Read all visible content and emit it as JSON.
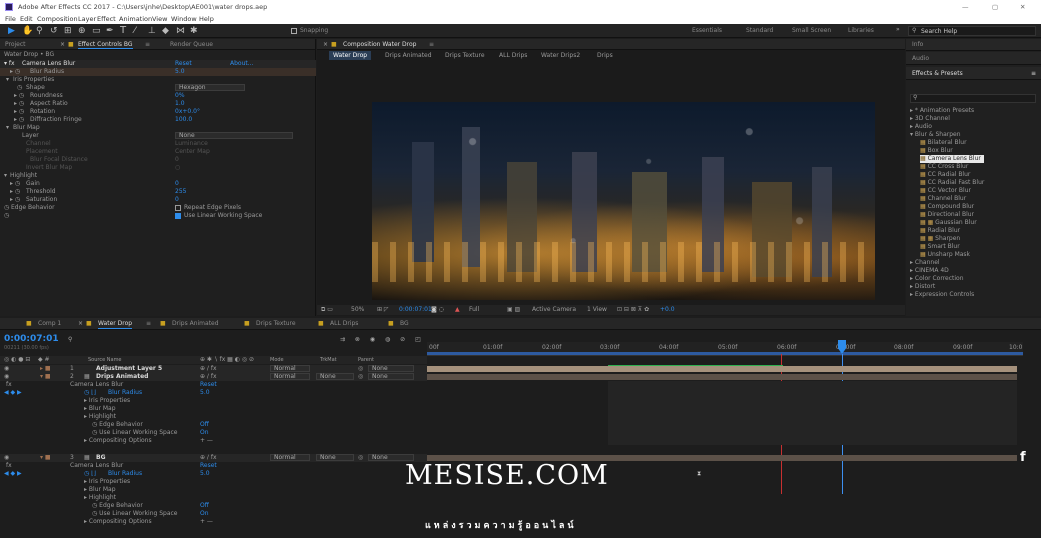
{
  "window": {
    "title": "Adobe After Effects CC 2017 - C:\\Users\\jnhe\\Desktop\\AE001\\water drops.aep",
    "controls": [
      "—",
      "▢",
      "✕"
    ]
  },
  "menu": [
    "File",
    "Edit",
    "Composition",
    "Layer",
    "Effect",
    "Animation",
    "View",
    "Window",
    "Help"
  ],
  "toolbar": {
    "snapping": "Snapping",
    "workspaces": [
      "Essentials",
      "Standard",
      "Small Screen",
      "Libraries"
    ],
    "more": "»",
    "search_placeholder": "Search Help"
  },
  "left_panel": {
    "tabs": [
      "Project",
      "Effect Controls BG",
      "Render Queue"
    ],
    "breadcrumb": "Water Drop • BG",
    "effect": {
      "name": "Camera Lens Blur",
      "reset": "Reset",
      "about": "About...",
      "blur_radius": {
        "label": "Blur Radius",
        "value": "5.0"
      },
      "iris_title": "Iris Properties",
      "shape": {
        "label": "Shape",
        "value": "Hexagon"
      },
      "roundness": {
        "label": "Roundness",
        "value": "0%"
      },
      "aspect_ratio": {
        "label": "Aspect Ratio",
        "value": "1.0"
      },
      "rotation": {
        "label": "Rotation",
        "value": "0x+0.0°"
      },
      "diffraction": {
        "label": "Diffraction Fringe",
        "value": "100.0"
      },
      "blur_map_title": "Blur Map",
      "layer": {
        "label": "Layer",
        "value": "None"
      },
      "channel": {
        "label": "Channel",
        "value": "Luminance"
      },
      "placement": {
        "label": "Placement",
        "value": "Center Map"
      },
      "blur_focal": {
        "label": "Blur Focal Distance",
        "value": "0"
      },
      "invert_blur": {
        "label": "Invert Blur Map"
      },
      "highlight_title": "Highlight",
      "gain": {
        "label": "Gain",
        "value": "0"
      },
      "threshold": {
        "label": "Threshold",
        "value": "255"
      },
      "saturation": {
        "label": "Saturation",
        "value": "0"
      },
      "edge": {
        "label": "Edge Behavior",
        "option": "Repeat Edge Pixels"
      },
      "linear": {
        "option": "Use Linear Working Space"
      }
    }
  },
  "comp_panel": {
    "title": "Composition Water Drop",
    "breadcrumbs": [
      "Water Drop",
      "Drips Animated",
      "Drips Texture",
      "ALL Drips",
      "Water Drips2",
      "Drips"
    ],
    "footer": {
      "zoom": "50%",
      "timecode": "0:00:07:01",
      "quality": "Full",
      "camera": "Active Camera",
      "view": "1 View",
      "exposure": "+0.0"
    }
  },
  "right_panel": {
    "info": "Info",
    "audio": "Audio",
    "effects_title": "Effects & Presets",
    "search": "",
    "categories": [
      "* Animation Presets",
      "3D Channel",
      "Audio"
    ],
    "open_category": "Blur & Sharpen",
    "items": [
      "Bilateral Blur",
      "Box Blur",
      "Camera Lens Blur",
      "CC Cross Blur",
      "CC Radial Blur",
      "CC Radial Fast Blur",
      "CC Vector Blur",
      "Channel Blur",
      "Compound Blur",
      "Directional Blur",
      "Gaussian Blur",
      "Radial Blur",
      "Sharpen",
      "Smart Blur",
      "Unsharp Mask"
    ],
    "more_categories": [
      "Channel",
      "CINEMA 4D",
      "Color Correction",
      "Distort",
      "Expression Controls"
    ]
  },
  "timeline": {
    "tabs": [
      "Comp 1",
      "Water Drop",
      "Drips Animated",
      "Drips Texture",
      "ALL Drips",
      "BG"
    ],
    "timecode": "0:00:07:01",
    "fps": "00211 (30.00 fps)",
    "ruler": [
      "00f",
      "01:00f",
      "02:00f",
      "03:00f",
      "04:00f",
      "05:00f",
      "06:00f",
      "07:00f",
      "08:00f",
      "09:00f",
      "10:0"
    ],
    "col_source": "Source Name",
    "col_mode": "Mode",
    "col_trkmat": "TrkMat",
    "col_parent": "Parent",
    "layers": [
      {
        "num": "1",
        "name": "Adjustment Layer 5",
        "mode": "Normal",
        "trk": "",
        "parent": "None"
      },
      {
        "num": "2",
        "name": "Drips Animated",
        "mode": "Normal",
        "trk": "None",
        "parent": "None"
      }
    ],
    "props": [
      "Camera Lens Blur",
      "Blur Radius",
      "Iris Properties",
      "Blur Map",
      "Highlight",
      "Edge Behavior",
      "Use Linear Working Space",
      "Compositing Options"
    ],
    "prop_values": {
      "reset": "Reset",
      "radius": "5.0",
      "off": "Off",
      "on": "On",
      "comp": "+ —"
    },
    "layer3": {
      "num": "3",
      "name": "BG",
      "mode": "Normal",
      "trk": "None",
      "parent": "None"
    },
    "layer3_props": [
      "Camera Lens Blur",
      "Blur Radius",
      "Iris Properties",
      "Blur Map",
      "Highlight",
      "Edge Behavior",
      "Use Linear Working Space",
      "Compositing Options"
    ]
  },
  "watermark": {
    "title": "MESISE.COM",
    "subtitle": "แหล่งรวมความรู้ออนไลน์",
    "fb": "f"
  }
}
